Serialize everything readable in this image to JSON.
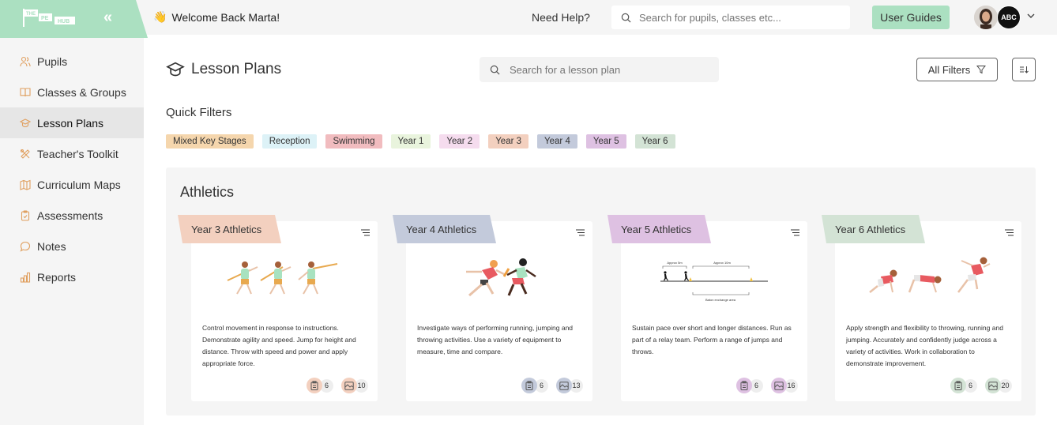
{
  "app": {
    "logo_text": [
      "THE",
      "PE",
      "HUB"
    ],
    "collapse_glyph": "«",
    "welcome_emoji": "👋",
    "welcome": "Welcome Back Marta!",
    "help": "Need Help?",
    "global_search_placeholder": "Search for pupils, classes etc...",
    "user_guides": "User Guides",
    "school_badge": "ABC"
  },
  "colors": {
    "brand_green": "#abe0c1",
    "nav_icon": "#e0a060"
  },
  "sidebar": {
    "items": [
      {
        "label": "Pupils",
        "icon": "users-icon"
      },
      {
        "label": "Classes & Groups",
        "icon": "book-icon"
      },
      {
        "label": "Lesson Plans",
        "icon": "graduation-cap-icon",
        "active": true
      },
      {
        "label": "Teacher's Toolkit",
        "icon": "tools-icon"
      },
      {
        "label": "Curriculum Maps",
        "icon": "map-icon"
      },
      {
        "label": "Assessments",
        "icon": "clipboard-check-icon"
      },
      {
        "label": "Notes",
        "icon": "chat-bubble-icon"
      },
      {
        "label": "Reports",
        "icon": "bar-chart-icon"
      }
    ]
  },
  "page": {
    "title": "Lesson Plans",
    "search_placeholder": "Search for a lesson plan",
    "all_filters": "All Filters",
    "quick_filters_label": "Quick Filters",
    "quick_filters": [
      {
        "label": "Mixed Key Stages",
        "color": "#f5d6ad"
      },
      {
        "label": "Reception",
        "color": "#ddf2f7"
      },
      {
        "label": "Swimming",
        "color": "#f1bcbf"
      },
      {
        "label": "Year 1",
        "color": "#e9f4dd"
      },
      {
        "label": "Year 2",
        "color": "#f5dcee"
      },
      {
        "label": "Year 3",
        "color": "#f3d0bf"
      },
      {
        "label": "Year 4",
        "color": "#c3cadb"
      },
      {
        "label": "Year 5",
        "color": "#dec1e2"
      },
      {
        "label": "Year 6",
        "color": "#d3e3d5"
      }
    ]
  },
  "section": {
    "title": "Athletics",
    "cards": [
      {
        "title": "Year 3 Athletics",
        "color": "#f3d0bf",
        "illustration": "javelin-throw",
        "description": "Control movement in response to instructions. Demonstrate agility and speed. Jump for height and distance. Throw with speed and power and apply appropriate force.",
        "lessons": "6",
        "resources": "10"
      },
      {
        "title": "Year 4 Athletics",
        "color": "#c3cadb",
        "illustration": "relay-baton-pass",
        "description": "Investigate ways of performing running, jumping and throwing activities. Use a variety of equipment to measure, time and compare.",
        "lessons": "6",
        "resources": "13"
      },
      {
        "title": "Year 5 Athletics",
        "color": "#dec1e2",
        "illustration": "relay-diagram",
        "description": "Sustain pace over short and longer distances. Run as part of a relay team. Perform a range of jumps and throws.",
        "lessons": "6",
        "resources": "16",
        "diagram_labels": [
          "Approx 5m",
          "Approx 10m",
          "Baton exchange area"
        ]
      },
      {
        "title": "Year 6 Athletics",
        "color": "#d3e3d5",
        "illustration": "sprint-start",
        "description": "Apply strength and flexibility to throwing, running and jumping. Accurately and confidently judge across a variety of activities. Work in collaboration to demonstrate improvement.",
        "lessons": "6",
        "resources": "20"
      }
    ]
  }
}
